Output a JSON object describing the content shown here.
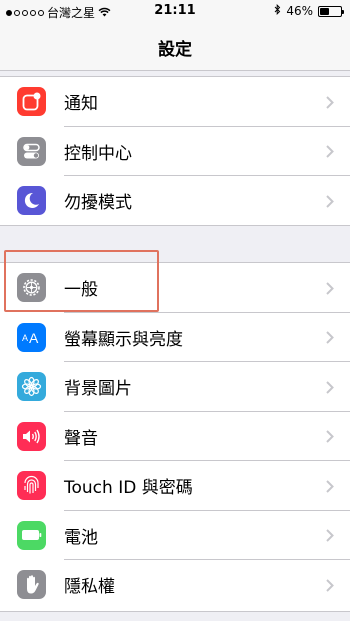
{
  "status_bar": {
    "carrier": "台灣之星",
    "time": "21:11",
    "battery": "46%",
    "battery_level": 0.46
  },
  "nav": {
    "title": "設定"
  },
  "groups": [
    {
      "items": [
        {
          "label": "通知",
          "icon": "notifications-icon",
          "color": "#ff3b30"
        },
        {
          "label": "控制中心",
          "icon": "control-center-icon",
          "color": "#8e8e93"
        },
        {
          "label": "勿擾模式",
          "icon": "moon-icon",
          "color": "#5856d6"
        }
      ]
    },
    {
      "items": [
        {
          "label": "一般",
          "icon": "gear-icon",
          "color": "#8e8e93"
        },
        {
          "label": "螢幕顯示與亮度",
          "icon": "display-brightness-icon",
          "color": "#007aff"
        },
        {
          "label": "背景圖片",
          "icon": "wallpaper-icon",
          "color": "#34aadc"
        },
        {
          "label": "聲音",
          "icon": "sound-icon",
          "color": "#ff2d55"
        },
        {
          "label": "Touch ID 與密碼",
          "icon": "fingerprint-icon",
          "color": "#ff2d55"
        },
        {
          "label": "電池",
          "icon": "battery-icon",
          "color": "#4cd964"
        },
        {
          "label": "隱私權",
          "icon": "hand-icon",
          "color": "#8e8e93"
        }
      ]
    }
  ]
}
